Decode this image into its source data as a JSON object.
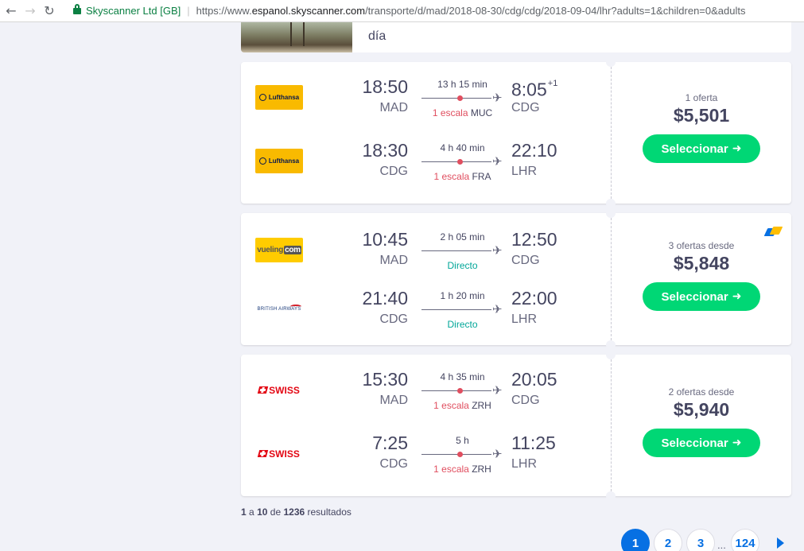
{
  "browser": {
    "site_name": "Skyscanner Ltd [GB]",
    "url_prefix": "https://www.",
    "url_host": "espanol.skyscanner.com",
    "url_path": "/transporte/d/mad/2018-08-30/cdg/cdg/2018-09-04/lhr?adults=1&children=0&adults"
  },
  "top_card": {
    "text": "día"
  },
  "results": [
    {
      "offers": "1 oferta",
      "price": "$5,501",
      "select_label": "Seleccionar",
      "deal_badge": false,
      "legs": [
        {
          "airline": "Lufthansa",
          "logo_text": "Lufthansa",
          "dep_time": "18:50",
          "dep_airport": "MAD",
          "duration": "13 h 15 min",
          "stop_count": "1 escala",
          "stop_airport": "MUC",
          "direct": false,
          "arr_time": "8:05",
          "arr_offset": "+1",
          "arr_airport": "CDG"
        },
        {
          "airline": "Lufthansa",
          "logo_text": "Lufthansa",
          "dep_time": "18:30",
          "dep_airport": "CDG",
          "duration": "4 h 40 min",
          "stop_count": "1 escala",
          "stop_airport": "FRA",
          "direct": false,
          "arr_time": "22:10",
          "arr_offset": "",
          "arr_airport": "LHR"
        }
      ]
    },
    {
      "offers": "3 ofertas desde",
      "price": "$5,848",
      "select_label": "Seleccionar",
      "deal_badge": true,
      "legs": [
        {
          "airline": "Vueling",
          "logo_text": "vueling",
          "logo_text_2": "com",
          "dep_time": "10:45",
          "dep_airport": "MAD",
          "duration": "2 h 05 min",
          "direct_label": "Directo",
          "direct": true,
          "arr_time": "12:50",
          "arr_offset": "",
          "arr_airport": "CDG"
        },
        {
          "airline": "British Airways",
          "logo_text": "BRITISH AIRWAYS",
          "dep_time": "21:40",
          "dep_airport": "CDG",
          "duration": "1 h 20 min",
          "direct_label": "Directo",
          "direct": true,
          "arr_time": "22:00",
          "arr_offset": "",
          "arr_airport": "LHR"
        }
      ]
    },
    {
      "offers": "2 ofertas desde",
      "price": "$5,940",
      "select_label": "Seleccionar",
      "deal_badge": false,
      "legs": [
        {
          "airline": "SWISS",
          "logo_text": "SWISS",
          "dep_time": "15:30",
          "dep_airport": "MAD",
          "duration": "4 h 35 min",
          "stop_count": "1 escala",
          "stop_airport": "ZRH",
          "direct": false,
          "arr_time": "20:05",
          "arr_offset": "",
          "arr_airport": "CDG"
        },
        {
          "airline": "SWISS",
          "logo_text": "SWISS",
          "dep_time": "7:25",
          "dep_airport": "CDG",
          "duration": "5 h",
          "stop_count": "1 escala",
          "stop_airport": "ZRH",
          "direct": false,
          "arr_time": "11:25",
          "arr_offset": "",
          "arr_airport": "LHR"
        }
      ]
    }
  ],
  "footer": {
    "range_start": "1",
    "range_sep": "a",
    "range_end": "10",
    "of_label": "de",
    "total": "1236",
    "results_label": "resultados",
    "pages": [
      "1",
      "2",
      "3"
    ],
    "ellipsis": "...",
    "last_page": "124",
    "current_page": "1"
  },
  "colors": {
    "accent": "#0770e3",
    "cta": "#00d775",
    "stops": "#e04e5f",
    "direct": "#00a698"
  }
}
